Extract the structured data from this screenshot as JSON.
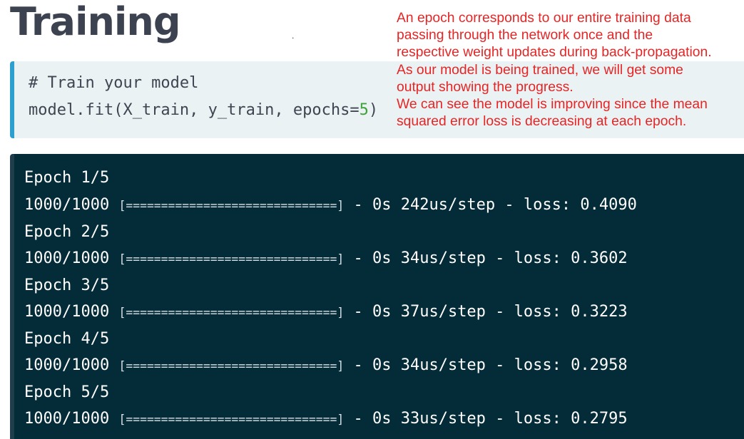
{
  "title": "Training",
  "stray_mark": ".",
  "code": {
    "comment": "# Train your model",
    "call_prefix": "model.fit(X_train, y_train, epochs=",
    "epochs_value": "5",
    "call_suffix": ")"
  },
  "annotation": [
    "An epoch corresponds to our entire training data",
    "passing through the network once and the",
    "respective weight updates during back-propagation.",
    "As our model is being trained, we will get some",
    "output showing the progress.",
    "We can see the model is improving since the mean",
    "squared error loss is decreasing at each epoch."
  ],
  "output": {
    "epochs": [
      {
        "header": "Epoch 1/5",
        "progress": "1000/1000",
        "bar": "[==============================]",
        "stats": " - 0s 242us/step - loss: 0.4090"
      },
      {
        "header": "Epoch 2/5",
        "progress": "1000/1000",
        "bar": "[==============================]",
        "stats": " - 0s 34us/step - loss: 0.3602"
      },
      {
        "header": "Epoch 3/5",
        "progress": "1000/1000",
        "bar": "[==============================]",
        "stats": " - 0s 37us/step - loss: 0.3223"
      },
      {
        "header": "Epoch 4/5",
        "progress": "1000/1000",
        "bar": "[==============================]",
        "stats": " - 0s 34us/step - loss: 0.2958"
      },
      {
        "header": "Epoch 5/5",
        "progress": "1000/1000",
        "bar": "[==============================]",
        "stats": " - 0s 33us/step - loss: 0.2795"
      }
    ]
  },
  "colors": {
    "title": "#3c4250",
    "annotation": "#e52525",
    "code_bg": "#eaf2f4",
    "code_accent": "#2f9fd0",
    "number": "#3fa33a",
    "output_bg": "#032b38"
  }
}
